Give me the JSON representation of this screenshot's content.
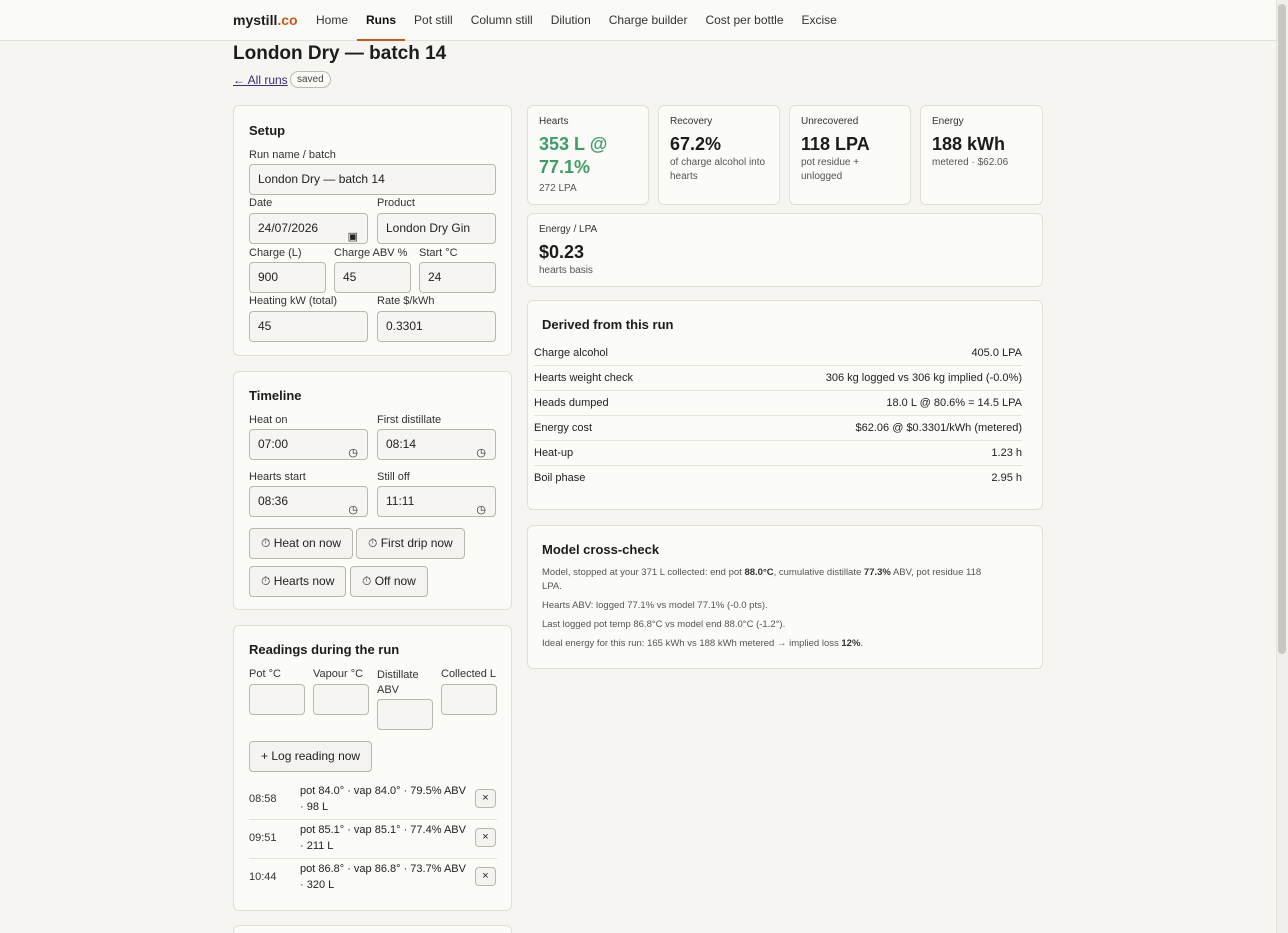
{
  "nav": {
    "brand_main": "mystill",
    "brand_suffix": ".co",
    "links": [
      "Home",
      "Runs",
      "Pot still",
      "Column still",
      "Dilution",
      "Charge builder",
      "Cost per bottle",
      "Excise"
    ],
    "active": "Runs"
  },
  "page": {
    "title": "London Dry — batch 14",
    "back_link": "← All runs",
    "saved_badge": "saved"
  },
  "setup": {
    "heading": "Setup",
    "run_name_label": "Run name / batch",
    "run_name_value": "London Dry — batch 14",
    "date_label": "Date",
    "date_value": "24/07/2026",
    "product_label": "Product",
    "product_value": "London Dry Gin",
    "charge_l_label": "Charge (L)",
    "charge_l_value": "900",
    "charge_abv_label": "Charge ABV %",
    "charge_abv_value": "45",
    "start_c_label": "Start °C",
    "start_c_value": "24",
    "heating_kw_label": "Heating kW (total)",
    "heating_kw_value": "45",
    "rate_label": "Rate $/kWh",
    "rate_value": "0.3301"
  },
  "timeline": {
    "heading": "Timeline",
    "heat_on_label": "Heat on",
    "heat_on_value": "07:00",
    "first_distillate_label": "First distillate",
    "first_distillate_value": "08:14",
    "hearts_start_label": "Hearts start",
    "hearts_start_value": "08:36",
    "still_off_label": "Still off",
    "still_off_value": "11:11",
    "btn_heat_on": "⏱ Heat on now",
    "btn_first_drip": "⏱ First drip now",
    "btn_hearts": "⏱ Hearts now",
    "btn_off": "⏱ Off now"
  },
  "readings": {
    "heading": "Readings during the run",
    "pot_label": "Pot °C",
    "vapour_label": "Vapour °C",
    "distillate_label_1": "Distillate",
    "distillate_label_2": "ABV",
    "collected_label": "Collected L",
    "log_button": "+ Log reading now",
    "remove_icon": "×",
    "rows": [
      {
        "time": "08:58",
        "text": "pot 84.0° · vap 84.0° · 79.5% ABV · 98 L"
      },
      {
        "time": "09:51",
        "text": "pot 85.1° · vap 85.1° · 77.4% ABV · 211 L"
      },
      {
        "time": "10:44",
        "text": "pot 86.8° · vap 86.8° · 73.7% ABV · 320 L"
      }
    ]
  },
  "stats": {
    "hearts": {
      "label": "Hearts",
      "value_1": "353 L @",
      "value_2": "77.1%",
      "sub": "272 LPA",
      "color": "#3f9c68"
    },
    "recovery": {
      "label": "Recovery",
      "value": "67.2%",
      "sub_1": "of charge alcohol into",
      "sub_2": "hearts"
    },
    "unrecovered": {
      "label": "Unrecovered",
      "value": "118 LPA",
      "sub_1": "pot residue +",
      "sub_2": "unlogged"
    },
    "energy": {
      "label": "Energy",
      "value": "188 kWh",
      "sub": "metered · $62.06"
    },
    "energy_per_lpa": {
      "label": "Energy / LPA",
      "value": "$0.23",
      "sub": "hearts basis"
    }
  },
  "derived": {
    "heading": "Derived from this run",
    "rows": [
      {
        "k": "Charge alcohol",
        "v": "405.0 LPA"
      },
      {
        "k": "Hearts weight check",
        "v": "306 kg logged vs 306 kg implied (-0.0%)"
      },
      {
        "k": "Heads dumped",
        "v": "18.0 L @ 80.6% = 14.5 LPA"
      },
      {
        "k": "Energy cost",
        "v": "$62.06 @ $0.3301/kWh (metered)"
      },
      {
        "k": "Heat-up",
        "v": "1.23 h"
      },
      {
        "k": "Boil phase",
        "v": "2.95 h"
      }
    ]
  },
  "model": {
    "heading": "Model cross-check",
    "line1_a": "Model, stopped at your 371 L collected: end pot ",
    "line1_b": "88.0°C",
    "line1_c": ", cumulative distillate ",
    "line1_d": "77.3%",
    "line1_e": " ABV, pot residue 118",
    "line1_f": "LPA.",
    "line2": "Hearts ABV: logged 77.1% vs model 77.1% (-0.0 pts).",
    "line3": "Last logged pot temp 86.8°C vs model end 88.0°C (-1.2°).",
    "line4_a": "Ideal energy for this run: 165 kWh vs 188 kWh metered → implied loss ",
    "line4_b": "12%",
    "line4_c": "."
  }
}
